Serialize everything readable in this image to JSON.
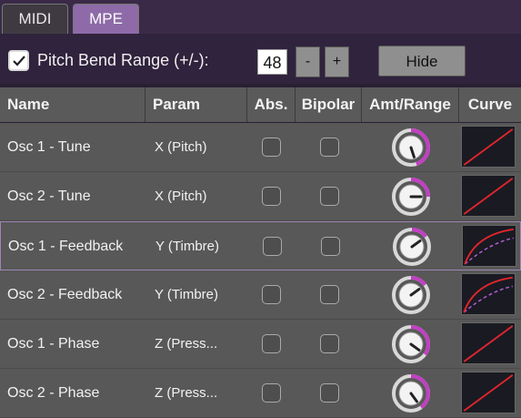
{
  "tabs": [
    {
      "label": "MIDI",
      "active": false
    },
    {
      "label": "MPE",
      "active": true
    }
  ],
  "pitch_bend": {
    "label": "Pitch Bend Range (+/-):",
    "checked": true,
    "value": "48",
    "minus_label": "-",
    "plus_label": "+"
  },
  "hide_label": "Hide",
  "columns": {
    "name": "Name",
    "param": "Param",
    "abs": "Abs.",
    "bipolar": "Bipolar",
    "amt_range": "Amt/Range",
    "curve": "Curve"
  },
  "rows": [
    {
      "name": "Osc 1 - Tune",
      "param": "X (Pitch)",
      "abs": false,
      "bipolar": false,
      "amount": 0.45,
      "curve": "linear"
    },
    {
      "name": "Osc 2 - Tune",
      "param": "X (Pitch)",
      "abs": false,
      "bipolar": false,
      "amount": 0.25,
      "curve": "linear"
    },
    {
      "name": "Osc 1 - Feedback",
      "param": "Y (Timbre)",
      "abs": false,
      "bipolar": false,
      "amount": 0.15,
      "curve": "log"
    },
    {
      "name": "Osc 2 - Feedback",
      "param": "Y (Timbre)",
      "abs": false,
      "bipolar": false,
      "amount": 0.15,
      "curve": "log"
    },
    {
      "name": "Osc 1 - Phase",
      "param": "Z (Press...",
      "abs": false,
      "bipolar": false,
      "amount": 0.35,
      "curve": "linear"
    },
    {
      "name": "Osc 2 - Phase",
      "param": "Z (Press...",
      "abs": false,
      "bipolar": false,
      "amount": 0.4,
      "curve": "linear"
    }
  ],
  "selected_row": 2,
  "colors": {
    "accent": "#c23fc4",
    "curve_line": "#e0262c",
    "curve_dashed": "#b35fd6",
    "tab_active": "#8e6ba8"
  }
}
